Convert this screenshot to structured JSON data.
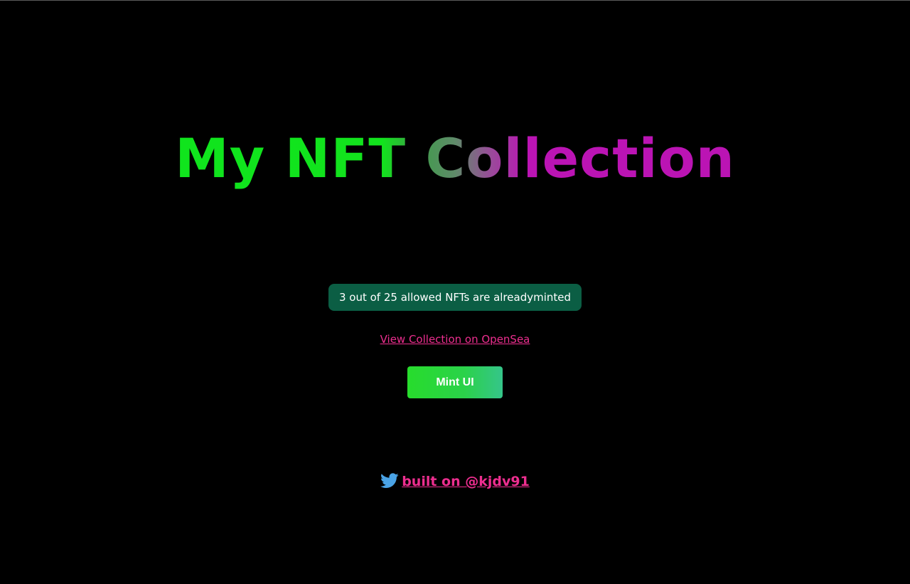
{
  "header": {
    "title": "My NFT Collection"
  },
  "status": {
    "minted_text": "3 out of 25 allowed NFTs are alreadyminted"
  },
  "links": {
    "opensea_label": "View Collection on OpenSea"
  },
  "actions": {
    "mint_label": "Mint UI"
  },
  "footer": {
    "twitter_label": "built on @kjdv91",
    "icon": "twitter-icon"
  },
  "colors": {
    "background": "#000000",
    "title_green": "#0ee51d",
    "title_magenta": "#bb14b4",
    "badge_bg": "#0b5e44",
    "link": "#ed2e8f",
    "button_green": "#27dc2c",
    "twitter_blue": "#4aa3e6"
  }
}
